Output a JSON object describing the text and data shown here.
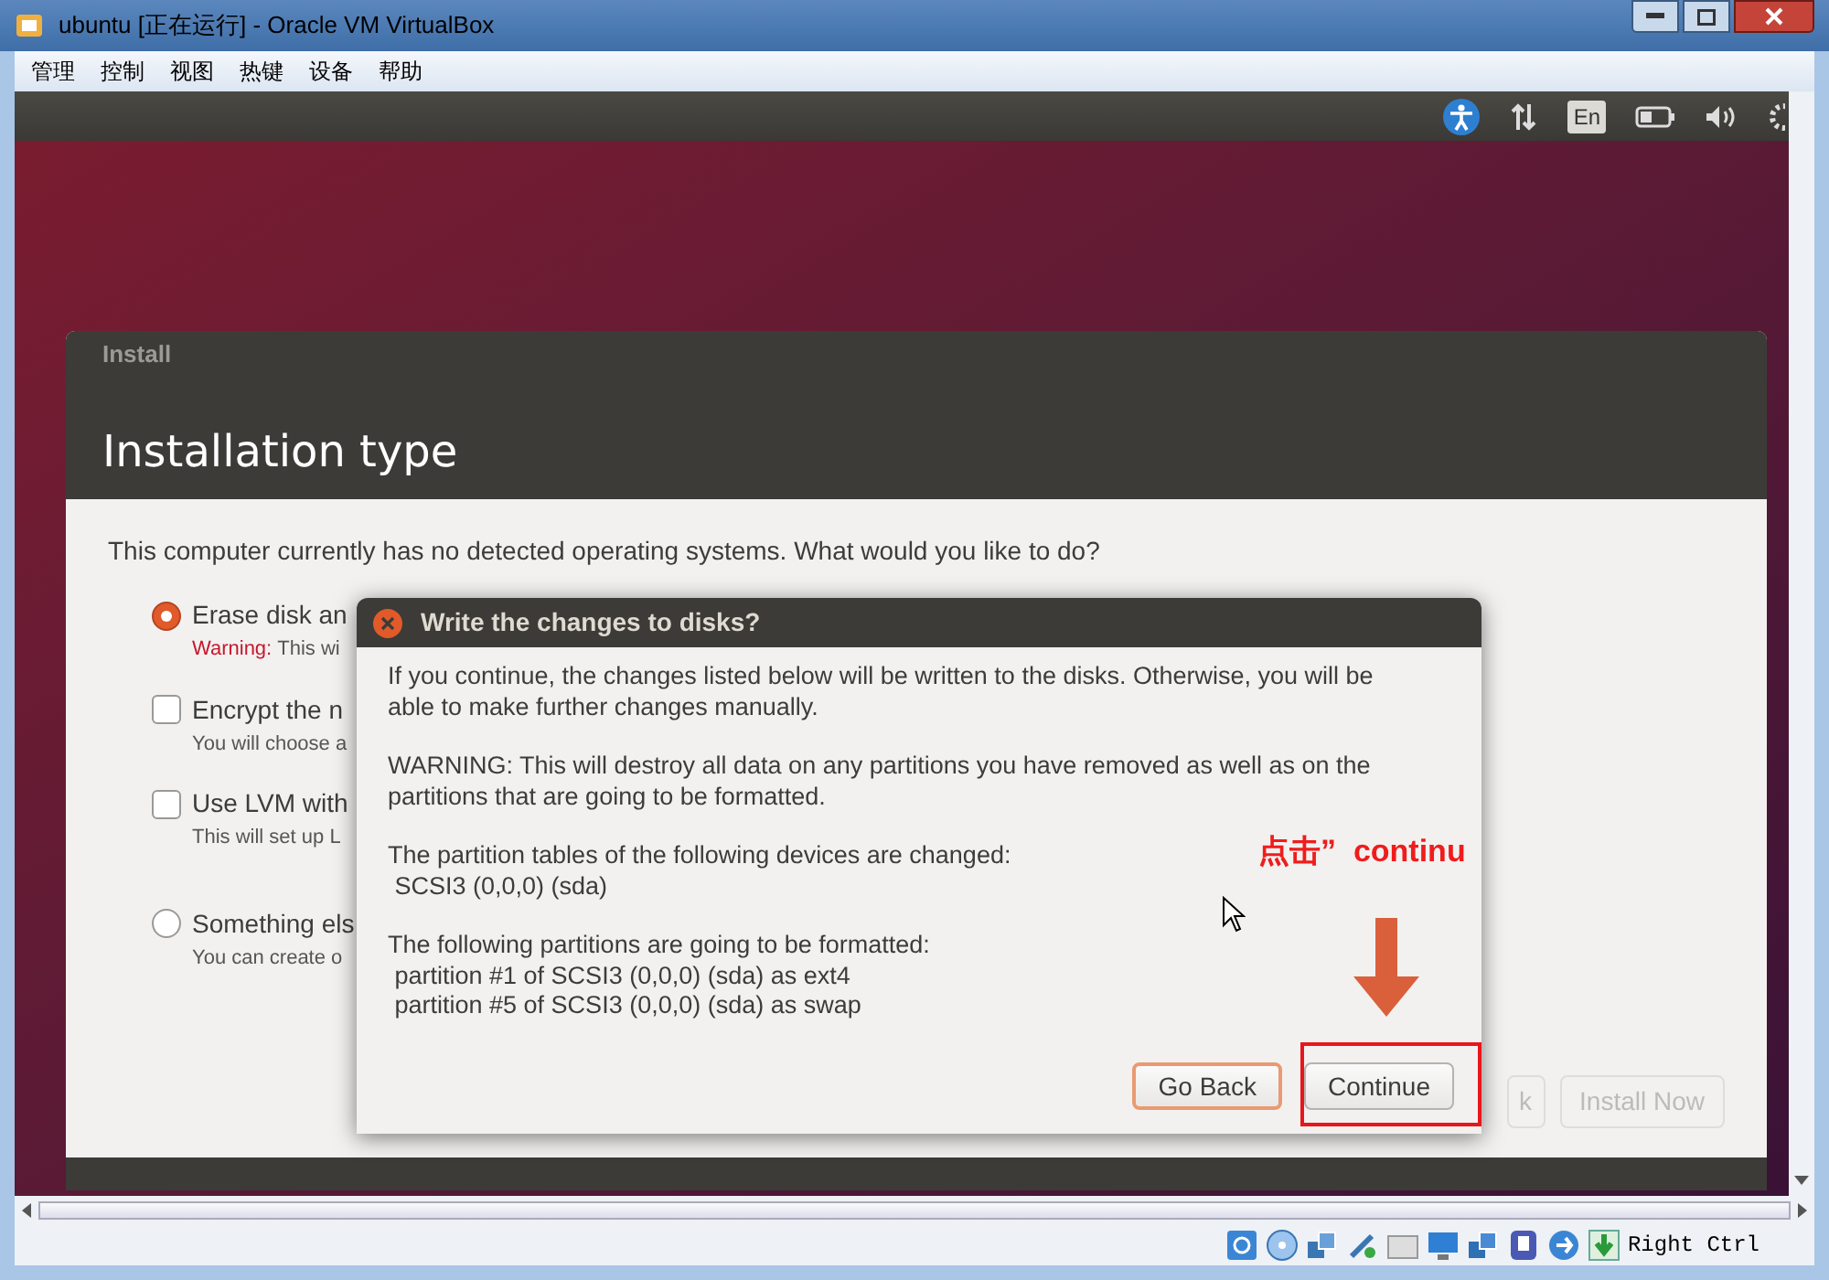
{
  "window": {
    "title": "ubuntu [正在运行] - Oracle VM VirtualBox"
  },
  "menu": [
    "管理",
    "控制",
    "视图",
    "热键",
    "设备",
    "帮助"
  ],
  "top_panel": {
    "keyboard_layout": "En"
  },
  "installer": {
    "caption": "Install",
    "title": "Installation type",
    "question": "This computer currently has no detected operating systems. What would you like to do?",
    "options": [
      {
        "kind": "radio",
        "label": "Erase disk an",
        "warning": "Warning:",
        "description": "This wi",
        "selected": true
      },
      {
        "kind": "checkbox",
        "label": "Encrypt the n",
        "description": "You will choose a",
        "checked": false
      },
      {
        "kind": "checkbox",
        "label": "Use LVM with",
        "description": "This will set up L",
        "checked": false
      },
      {
        "kind": "radio",
        "label": "Something els",
        "description": "You can create o",
        "selected": false
      }
    ],
    "hidden_buttons": [
      "k",
      "Install Now"
    ]
  },
  "dialog": {
    "title": "Write the changes to disks?",
    "blocks": [
      [
        "If you continue, the changes listed below will be written to the disks. Otherwise, you will be",
        "able to make further changes manually."
      ],
      [
        "WARNING: This will destroy all data on any partitions you have removed as well as on the",
        "partitions that are going to be formatted."
      ],
      [
        "The partition tables of the following devices are changed:",
        " SCSI3 (0,0,0) (sda)"
      ],
      [
        "The following partitions are going to be formatted:",
        " partition #1 of SCSI3 (0,0,0) (sda) as ext4",
        " partition #5 of SCSI3 (0,0,0) (sda) as swap"
      ]
    ],
    "buttons": [
      {
        "label": "Go Back",
        "focused": true
      },
      {
        "label": "Continue",
        "focused": false
      }
    ]
  },
  "annotation": "点击”  continu",
  "status_bar": {
    "host_key": "Right Ctrl"
  }
}
